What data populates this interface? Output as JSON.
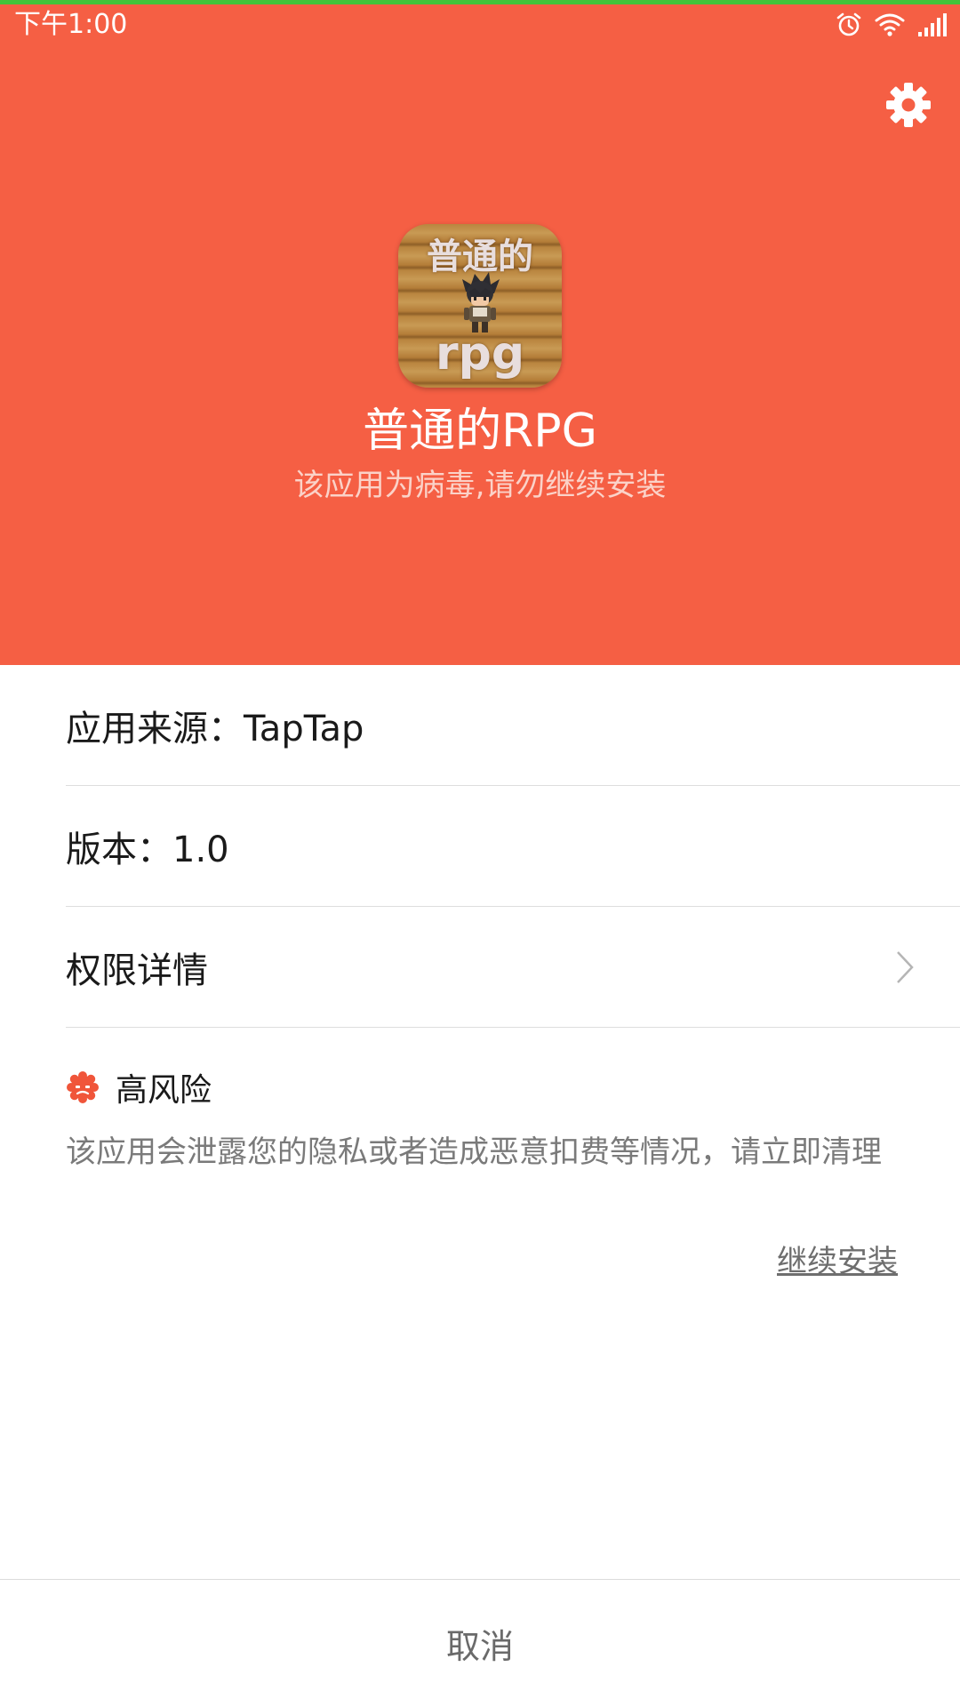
{
  "status_bar": {
    "time": "下午1:00",
    "icons": [
      "alarm-icon",
      "wifi-icon",
      "signal-icon"
    ]
  },
  "header": {
    "background_color": "#f55f44",
    "settings_icon": "gear-icon",
    "app_icon": {
      "top_text": "普通的",
      "bottom_text": "rpg"
    },
    "app_name": "普通的RPG",
    "warning": "该应用为病毒,请勿继续安装"
  },
  "info": {
    "source": "应用来源：TapTap",
    "version": "版本：1.0",
    "permissions_label": "权限详情"
  },
  "risk": {
    "icon": "risk-badge-icon",
    "title": "高风险",
    "description": "该应用会泄露您的隐私或者造成恶意扣费等情况，请立即清理",
    "continue_label": "继续安装",
    "accent_color": "#f0553a"
  },
  "bottom": {
    "cancel_label": "取消"
  }
}
